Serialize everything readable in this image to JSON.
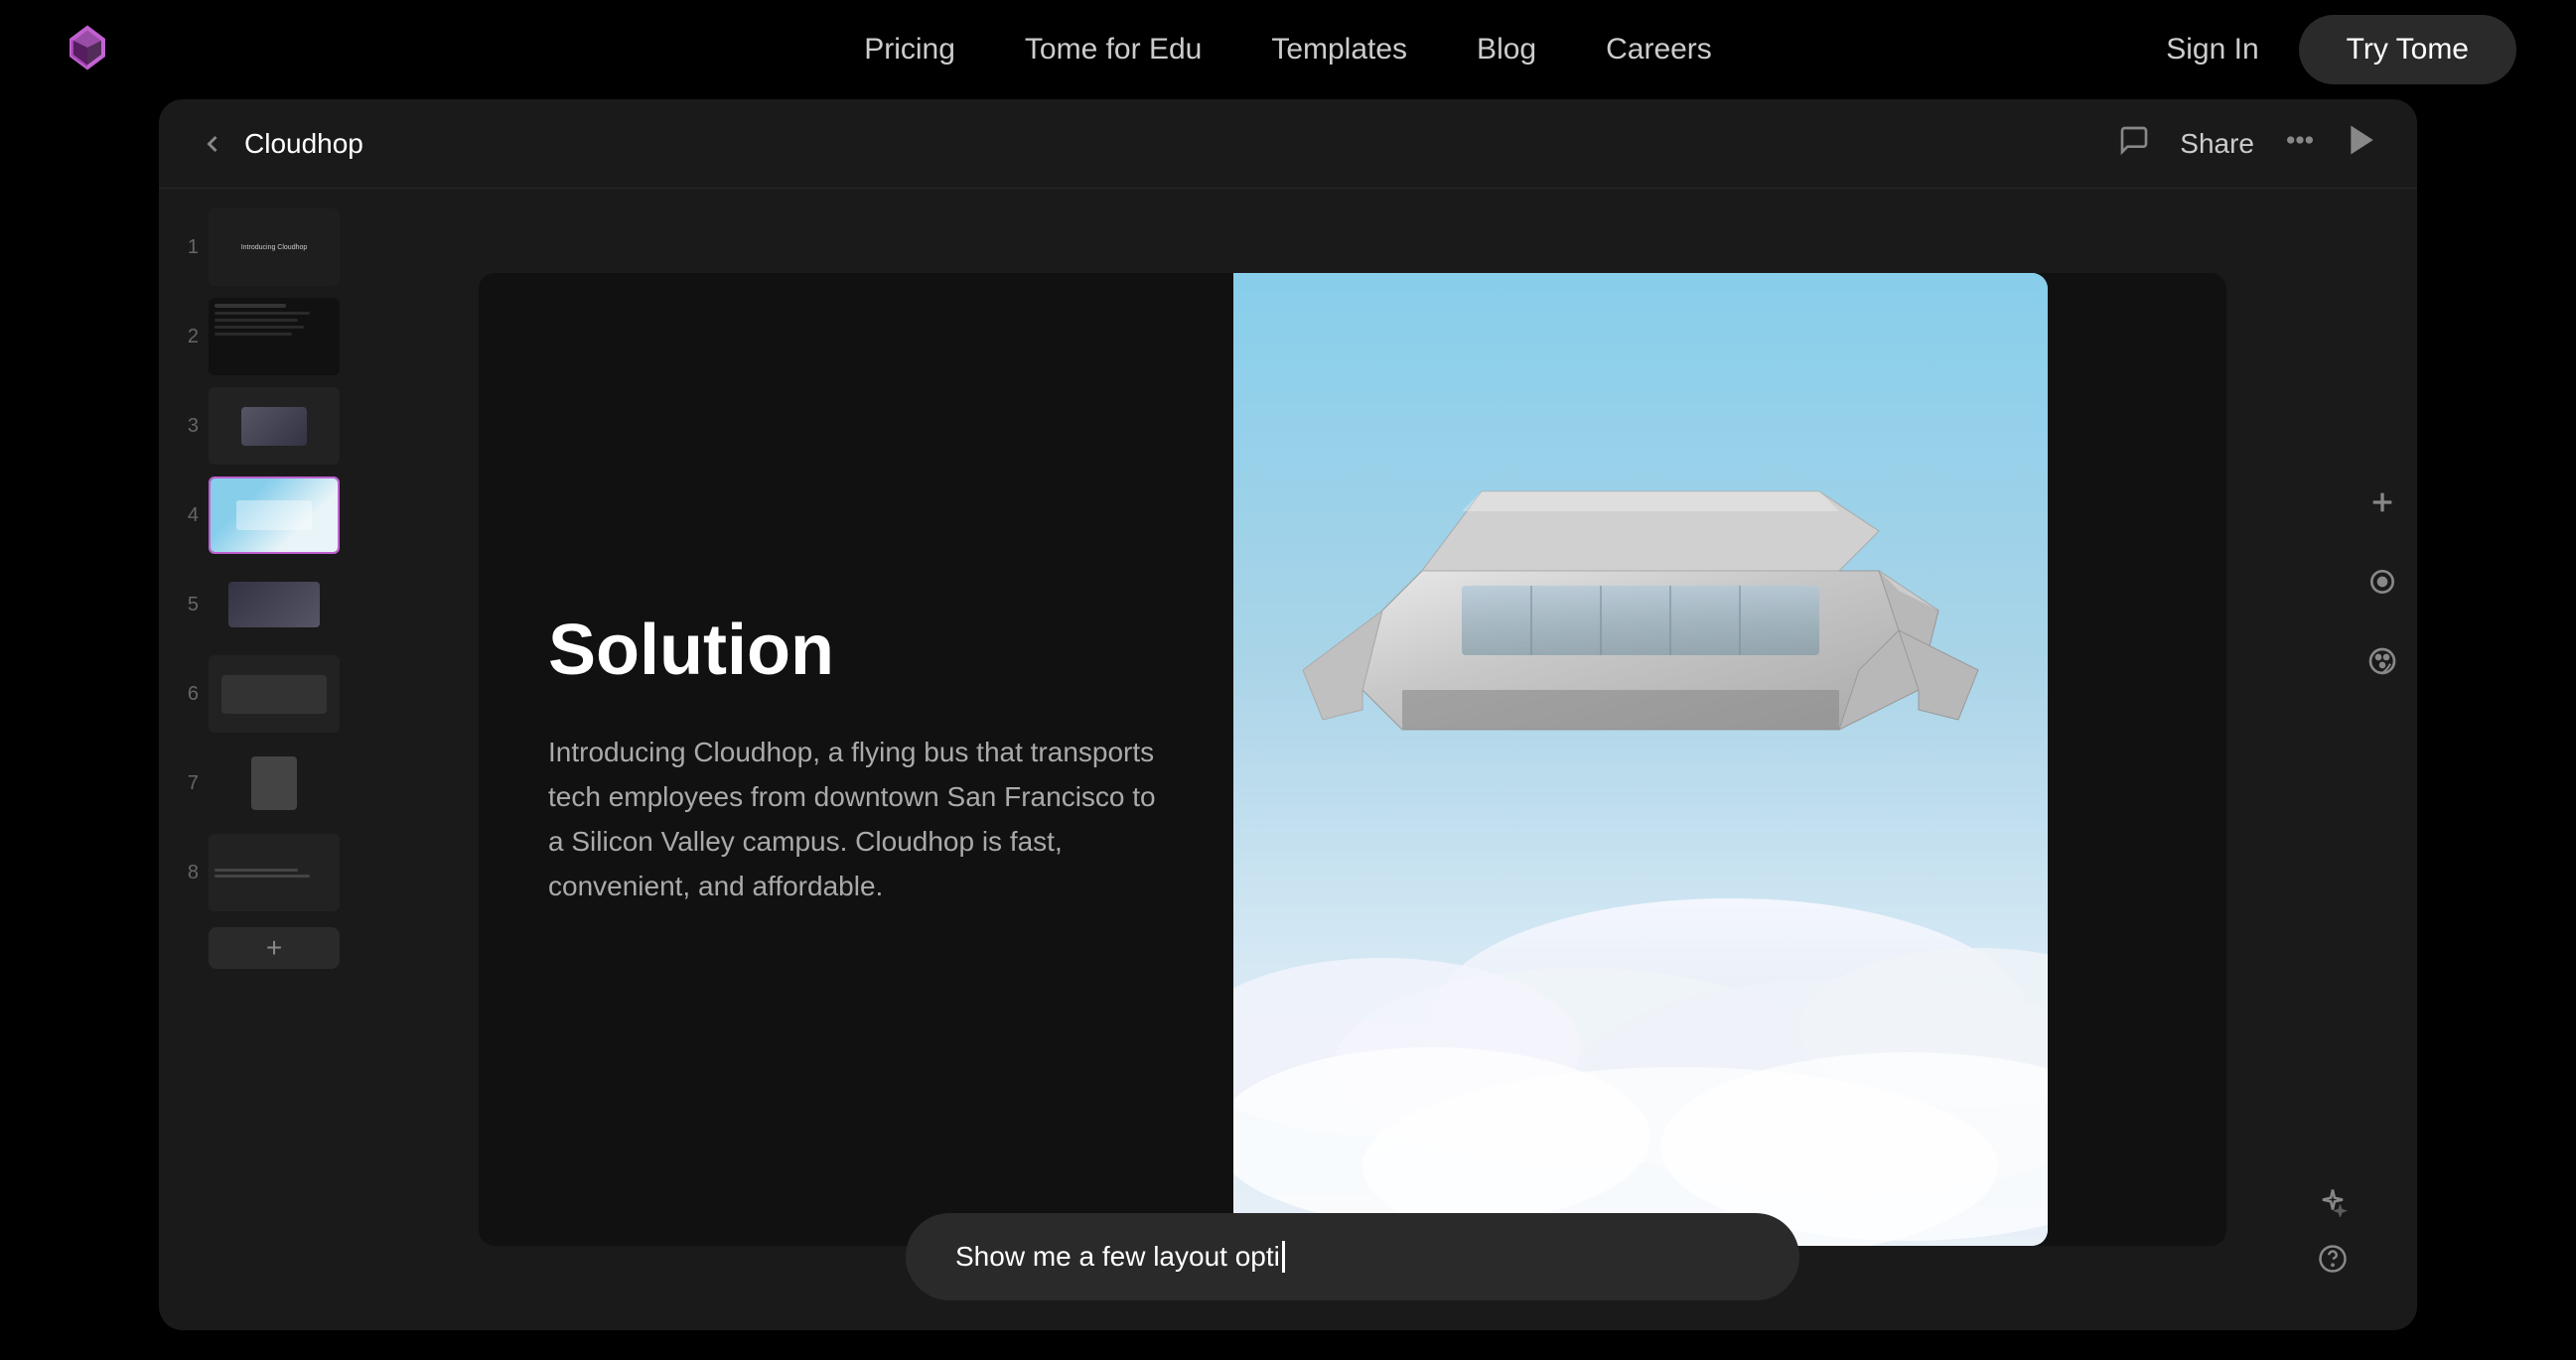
{
  "nav": {
    "logo_alt": "Tome logo",
    "links": [
      {
        "label": "Pricing",
        "id": "pricing"
      },
      {
        "label": "Tome for Edu",
        "id": "tome-for-edu"
      },
      {
        "label": "Templates",
        "id": "templates"
      },
      {
        "label": "Blog",
        "id": "blog"
      },
      {
        "label": "Careers",
        "id": "careers"
      }
    ],
    "sign_in": "Sign In",
    "try_tome": "Try Tome"
  },
  "app": {
    "title": "Cloudhop",
    "toolbar": {
      "share_label": "Share",
      "more_icon": "more-horizontal",
      "play_icon": "play"
    },
    "slides": [
      {
        "num": "1",
        "label": "Slide 1"
      },
      {
        "num": "2",
        "label": "Slide 2"
      },
      {
        "num": "3",
        "label": "Slide 3"
      },
      {
        "num": "4",
        "label": "Slide 4",
        "active": true
      },
      {
        "num": "5",
        "label": "Slide 5"
      },
      {
        "num": "6",
        "label": "Slide 6"
      },
      {
        "num": "7",
        "label": "Slide 7"
      },
      {
        "num": "8",
        "label": "Slide 8"
      }
    ],
    "add_slide_label": "+",
    "current_slide": {
      "heading": "Solution",
      "body": "Introducing Cloudhop, a flying bus that transports tech employees from downtown San Francisco to a Silicon Valley campus. Cloudhop is fast, convenient, and affordable."
    },
    "ai_input": {
      "value": "Show me a few layout opti",
      "placeholder": "Show me a few layout opti"
    }
  }
}
